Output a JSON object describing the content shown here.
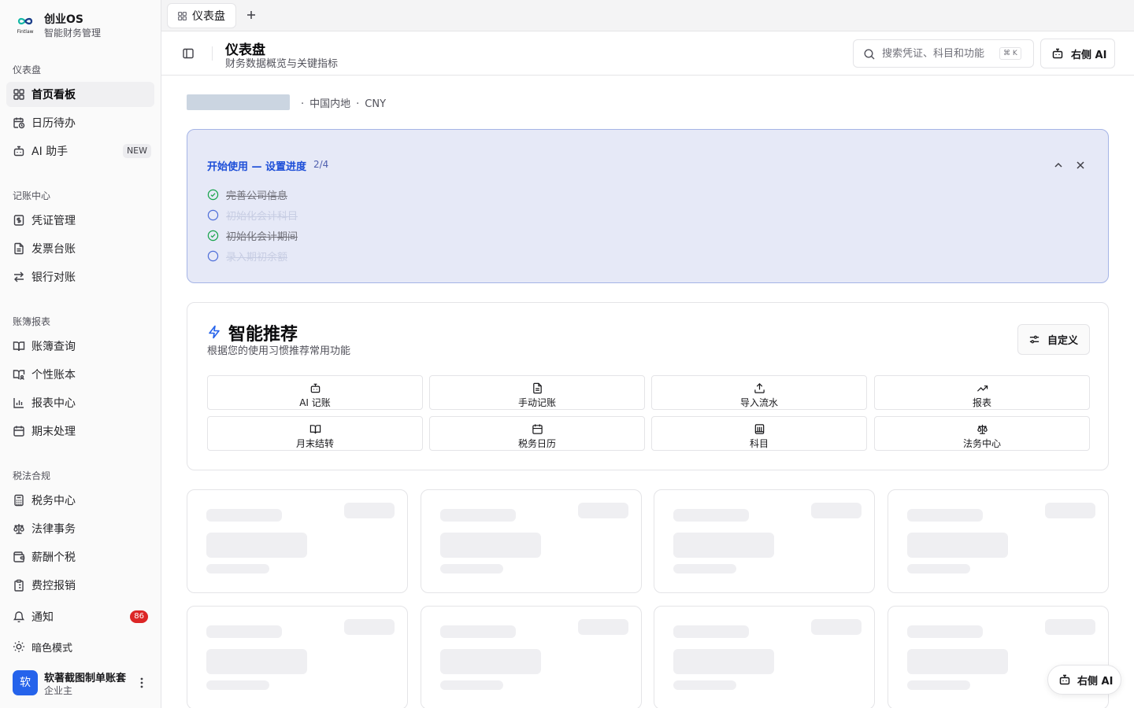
{
  "brand": {
    "name": "创业OS",
    "subtitle": "智能财务管理",
    "logo_text": "Fintlaw"
  },
  "sidebar": {
    "sections": [
      {
        "title": "仪表盘",
        "items": [
          {
            "label": "首页看板",
            "icon": "layout-grid-icon",
            "active": true
          },
          {
            "label": "日历待办",
            "icon": "calendar-clock-icon"
          },
          {
            "label": "AI 助手",
            "icon": "bot-icon",
            "badge": "NEW"
          }
        ]
      },
      {
        "title": "记账中心",
        "items": [
          {
            "label": "凭证管理",
            "icon": "receipt-icon"
          },
          {
            "label": "发票台账",
            "icon": "file-text-icon"
          },
          {
            "label": "银行对账",
            "icon": "arrows-left-right-icon"
          }
        ]
      },
      {
        "title": "账簿报表",
        "items": [
          {
            "label": "账簿查询",
            "icon": "book-open-icon"
          },
          {
            "label": "个性账本",
            "icon": "book-user-icon"
          },
          {
            "label": "报表中心",
            "icon": "bar-chart-icon"
          },
          {
            "label": "期末处理",
            "icon": "calendar-icon"
          }
        ]
      },
      {
        "title": "税法合规",
        "items": [
          {
            "label": "税务中心",
            "icon": "calculator-icon"
          },
          {
            "label": "法律事务",
            "icon": "scale-icon"
          },
          {
            "label": "薪酬个税",
            "icon": "wallet-icon"
          },
          {
            "label": "费控报销",
            "icon": "clipboard-list-icon"
          }
        ]
      }
    ],
    "notifications": {
      "label": "通知",
      "count": "86",
      "icon": "bell-icon"
    },
    "theme": {
      "label": "暗色模式",
      "icon": "sun-icon"
    },
    "user": {
      "avatar": "软",
      "name": "软著截图制单账套",
      "role": "企业主"
    }
  },
  "tabs": [
    {
      "label": "仪表盘",
      "icon": "layout-grid-icon"
    }
  ],
  "header": {
    "title": "仪表盘",
    "subtitle": "财务数据概览与关键指标",
    "search_placeholder": "搜索凭证、科目和功能",
    "search_shortcut": "⌘ K",
    "ai_button": "右侧 AI"
  },
  "company": {
    "region": "中国内地",
    "currency": "CNY",
    "separator": "·"
  },
  "setup": {
    "title": "开始使用 — 设置进度",
    "progress": "2/4",
    "steps": [
      {
        "label": "完善公司信息",
        "done": true
      },
      {
        "label": "初始化会计科目",
        "done": false
      },
      {
        "label": "初始化会计期间",
        "done": true
      },
      {
        "label": "录入期初余额",
        "done": false
      }
    ]
  },
  "recommend": {
    "title": "智能推荐",
    "subtitle": "根据您的使用习惯推荐常用功能",
    "customize": "自定义",
    "shortcuts": [
      {
        "label": "AI 记账",
        "icon": "bot-icon"
      },
      {
        "label": "手动记账",
        "icon": "file-text-icon"
      },
      {
        "label": "导入流水",
        "icon": "upload-icon"
      },
      {
        "label": "报表",
        "icon": "trending-up-icon"
      },
      {
        "label": "月末结转",
        "icon": "book-open-icon"
      },
      {
        "label": "税务日历",
        "icon": "calendar-icon"
      },
      {
        "label": "科目",
        "icon": "library-icon"
      },
      {
        "label": "法务中心",
        "icon": "scale-icon"
      }
    ]
  },
  "float_ai": "右侧 AI",
  "colors": {
    "accent": "#2563eb",
    "setup_bg": "#e6e9f7",
    "done_green": "#16a34a",
    "badge_red": "#dc2626"
  }
}
